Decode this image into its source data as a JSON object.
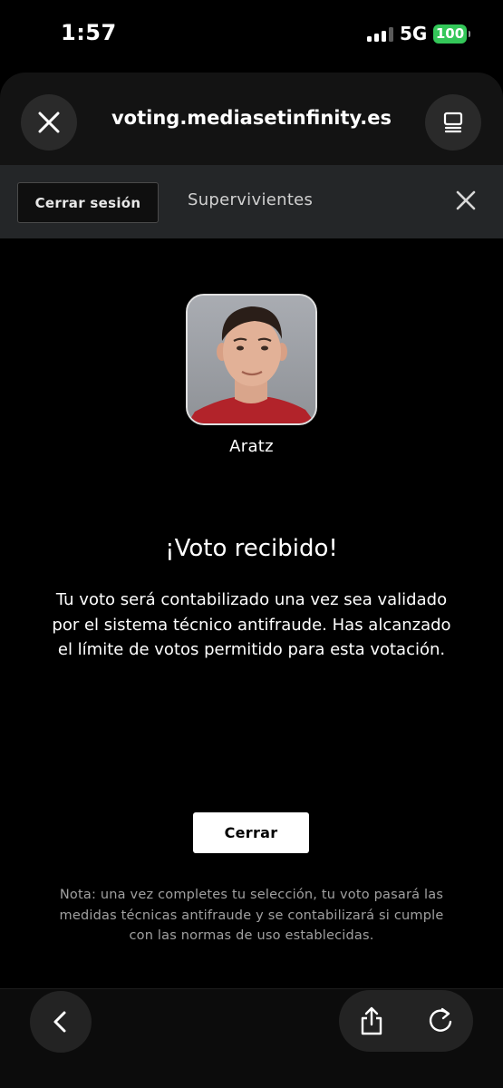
{
  "status_bar": {
    "time": "1:57",
    "network": "5G",
    "battery": "100",
    "battery_color": "#34c759"
  },
  "browser": {
    "url": "voting.mediasetinfinity.es",
    "close_icon": "close-icon",
    "tabs_icon": "tabs-icon"
  },
  "site_nav": {
    "logout_label": "Cerrar sesión",
    "section_title": "Supervivientes",
    "close_icon": "close-icon"
  },
  "candidate": {
    "name": "Aratz"
  },
  "confirmation": {
    "title": "¡Voto recibido!",
    "message": "Tu voto será contabilizado una vez sea validado por el sistema técnico antifraude. Has alcanzado el límite de votos permitido para esta votación.",
    "close_label": "Cerrar",
    "note": "Nota: una vez completes tu selección, tu voto pasará las medidas técnicas antifraude y se contabilizará si cumple con las normas de uso establecidas."
  },
  "toolbar": {
    "back_icon": "chevron-left-icon",
    "share_icon": "share-icon",
    "reload_icon": "reload-icon"
  }
}
